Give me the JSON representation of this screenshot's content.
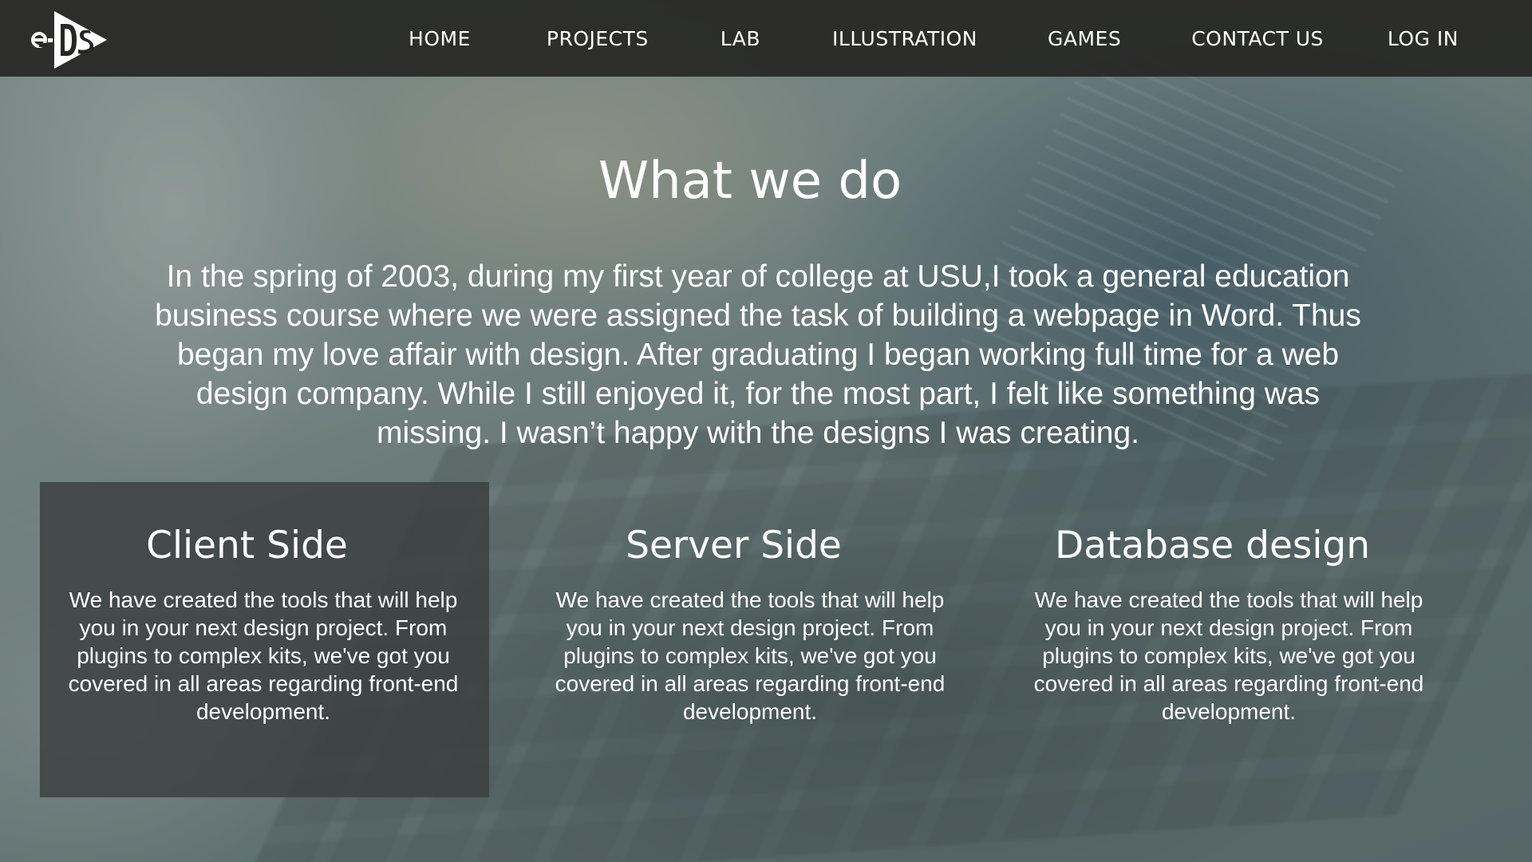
{
  "nav": {
    "logo_text": "e-Ds",
    "items": [
      {
        "label": "HOME"
      },
      {
        "label": "PROJECTS"
      },
      {
        "label": "LAB"
      },
      {
        "label": "ILLUSTRATION"
      },
      {
        "label": "GAMES"
      },
      {
        "label": "CONTACT US"
      },
      {
        "label": "LOG IN"
      }
    ]
  },
  "main": {
    "title": "What we do",
    "intro": "In the spring of 2003, during my first year of college at USU,I took a general education business course where we were assigned the task of building a webpage in Word. Thus began my love affair with design. After graduating I began working full time for a web design company. While I still enjoyed it, for the most part, I felt like something was missing. I wasn’t happy with the designs I was creating."
  },
  "cards": [
    {
      "title": "Client Side",
      "text": "We have created the tools that will help you in your next design project. From plugins to complex kits, we've got you covered in all areas regarding front-end development.",
      "active": true
    },
    {
      "title": "Server Side",
      "text": "We have created the tools that will help you in your next design project. From plugins to complex kits, we've got you covered in all areas regarding front-end development.",
      "active": false
    },
    {
      "title": "Database design",
      "text": "We have created the tools that will help you in your next design project. From plugins to complex kits, we've got you covered in all areas regarding front-end development.",
      "active": false
    }
  ],
  "colors": {
    "navbar_bg": "#262624",
    "card_active_bg": "#3a3e3e",
    "text": "#ffffff"
  }
}
